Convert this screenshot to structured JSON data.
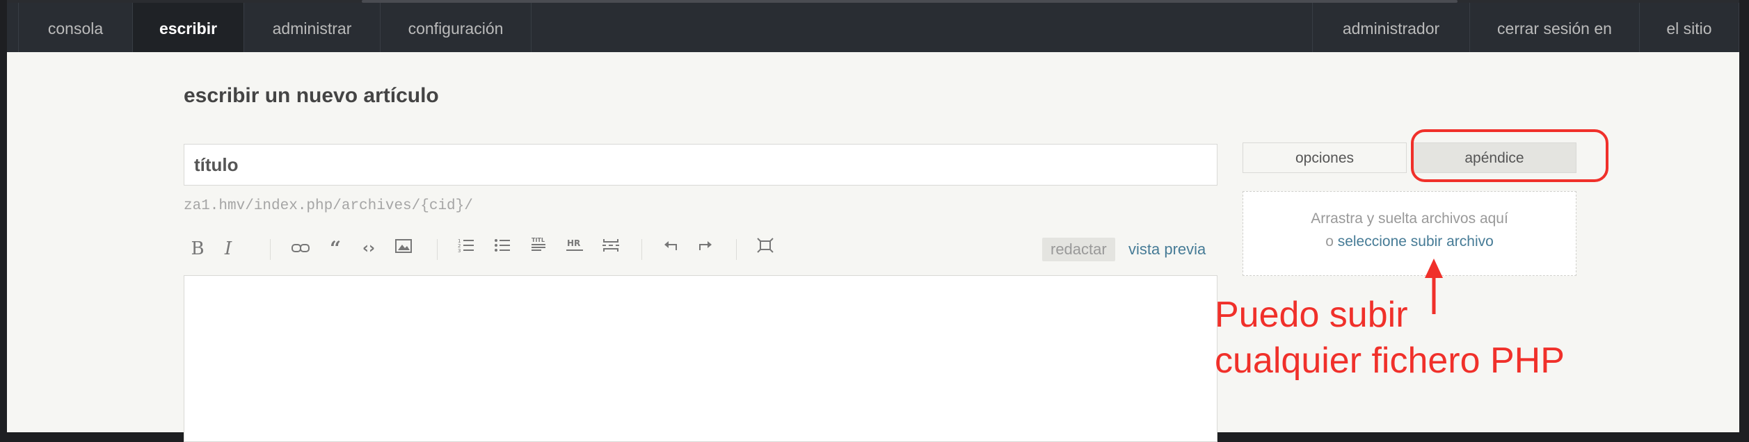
{
  "nav": {
    "left": [
      "consola",
      "escribir",
      "administrar",
      "configuración"
    ],
    "active_index": 1,
    "right": [
      "administrador",
      "cerrar sesión en",
      "el sitio"
    ]
  },
  "page": {
    "heading": "escribir un nuevo artículo",
    "title_placeholder": "título",
    "permalink": "za1.hmv/index.php/archives/{cid}/"
  },
  "toolbar": {
    "bold_icon": "bold-icon",
    "buttons": [
      "B",
      "I"
    ],
    "mode_write": "redactar",
    "mode_preview": "vista previa"
  },
  "sidebar": {
    "tab_options": "opciones",
    "tab_appendix": "apéndice",
    "dropzone_line1": "Arrastra y suelta archivos aquí",
    "dropzone_prefix": "o ",
    "dropzone_link": "seleccione subir archivo"
  },
  "annotation": {
    "line1": "Puedo subir",
    "line2": "cualquier fichero PHP",
    "color": "#f0302a"
  },
  "colors": {
    "navbar": "#292d33",
    "accent_link": "#467b96",
    "page_bg": "#f6f6f3"
  }
}
